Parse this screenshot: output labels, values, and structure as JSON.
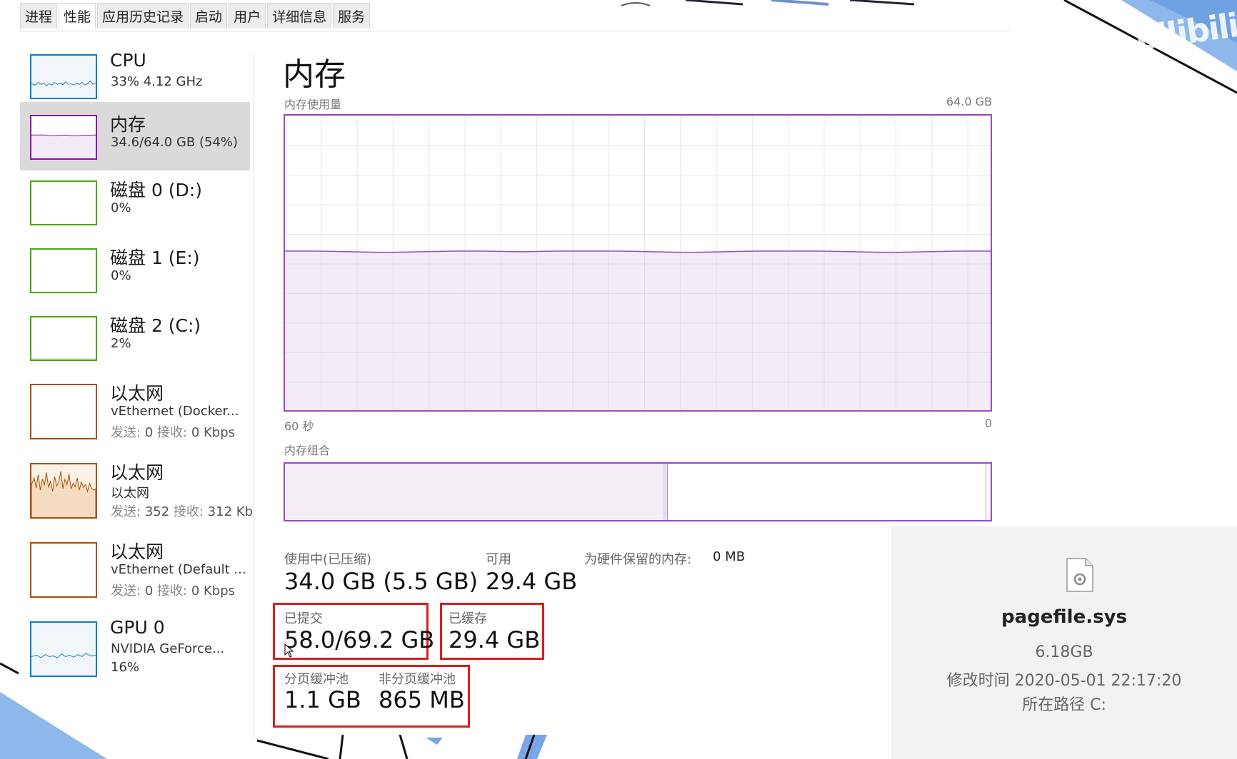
{
  "tabs": [
    "进程",
    "性能",
    "应用历史记录",
    "启动",
    "用户",
    "详细信息",
    "服务"
  ],
  "sidebar": [
    {
      "title": "CPU",
      "sub": "33% 4.12 GHz",
      "color": "#117dbb"
    },
    {
      "title": "内存",
      "sub": "34.6/64.0 GB (54%)",
      "color": "#8b12ae"
    },
    {
      "title": "磁盘 0 (D:)",
      "sub": "0%",
      "color": "#4da60c"
    },
    {
      "title": "磁盘 1 (E:)",
      "sub": "0%",
      "color": "#4da60c"
    },
    {
      "title": "磁盘 2 (C:)",
      "sub": "2%",
      "color": "#4da60c"
    },
    {
      "title": "以太网",
      "sub": "vEthernet (Docker...",
      "send_label": "发送:",
      "send": "0",
      "recv_label": "接收:",
      "recv": "0 Kbps",
      "color": "#a74f01"
    },
    {
      "title": "以太网",
      "sub": "以太网",
      "send_label": "发送:",
      "send": "352",
      "recv_label": "接收:",
      "recv": "312 Kb",
      "color": "#a74f01"
    },
    {
      "title": "以太网",
      "sub": "vEthernet (Default ...",
      "send_label": "发送:",
      "send": "0",
      "recv_label": "接收:",
      "recv": "0 Kbps",
      "color": "#a74f01"
    },
    {
      "title": "GPU 0",
      "sub": "NVIDIA GeForce...",
      "sub2": "16%",
      "color": "#117dbb"
    }
  ],
  "main": {
    "title": "内存",
    "usage_label": "内存使用量",
    "max_label": "64.0 GB",
    "time_left": "60 秒",
    "time_right": "0",
    "composition_label": "内存组合",
    "usage_fraction": 0.54,
    "composition": {
      "in_use_fraction": 0.535,
      "modified_fraction": 0.007
    }
  },
  "stats": {
    "in_use_label": "使用中(已压缩)",
    "in_use_value": "34.0 GB (5.5 GB)",
    "available_label": "可用",
    "available_value": "29.4 GB",
    "reserved_label": "为硬件保留的内存:",
    "reserved_value": "0 MB",
    "committed_label": "已提交",
    "committed_value": "58.0/69.2 GB",
    "cached_label": "已缓存",
    "cached_value": "29.4 GB",
    "paged_label": "分页缓冲池",
    "paged_value": "1.1 GB",
    "nonpaged_label": "非分页缓冲池",
    "nonpaged_value": "865 MB"
  },
  "pagefile": {
    "name": "pagefile.sys",
    "size": "6.18GB",
    "modified": "修改时间 2020-05-01 22:17:20",
    "path": "所在路径 C:"
  },
  "colors": {
    "memory_accent": "#9b4ac4",
    "highlight_box": "#d42020"
  }
}
